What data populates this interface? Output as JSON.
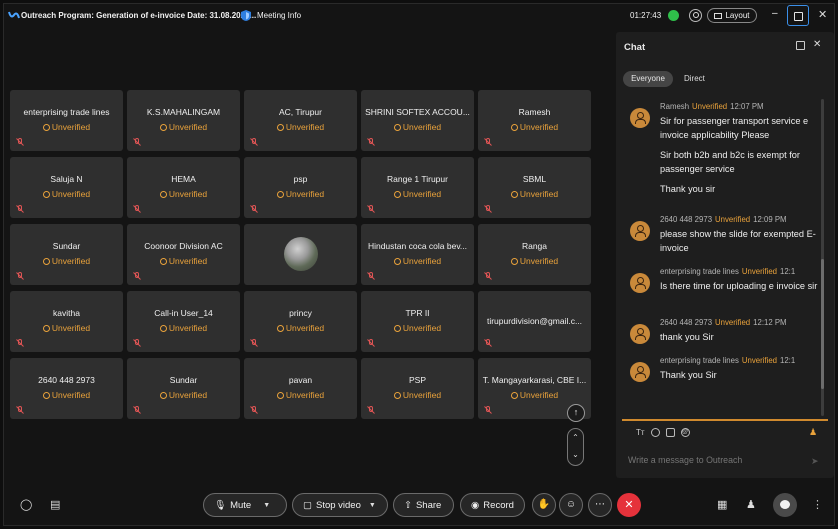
{
  "titlebar": {
    "meeting_title": "Outreach Program: Generation of e-invoice Date: 31.08.2023...",
    "meeting_info": "Meeting Info",
    "timer": "01:27:43",
    "layout_label": "Layout"
  },
  "colors": {
    "unverified": "#e9a23b",
    "end_call": "#e5323b",
    "accent_border": "#3b8fe8",
    "green_status": "#2fbf4a"
  },
  "participants": [
    [
      {
        "name": "enterprising trade lines",
        "status": "Unverified"
      },
      {
        "name": "K.S.MAHALINGAM",
        "status": "Unverified"
      },
      {
        "name": "AC, Tirupur",
        "status": "Unverified"
      },
      {
        "name": "SHRINI SOFTEX ACCOU...",
        "status": "Unverified"
      },
      {
        "name": "Ramesh",
        "status": "Unverified"
      }
    ],
    [
      {
        "name": "Saluja N",
        "status": "Unverified"
      },
      {
        "name": "HEMA",
        "status": "Unverified"
      },
      {
        "name": "psp",
        "status": "Unverified"
      },
      {
        "name": "Range 1 Tirupur",
        "status": "Unverified"
      },
      {
        "name": "SBML",
        "status": "Unverified"
      }
    ],
    [
      {
        "name": "Sundar",
        "status": "Unverified"
      },
      {
        "name": "Coonoor Division AC",
        "status": "Unverified"
      },
      {
        "name": "",
        "status": ""
      },
      {
        "name": "Hindustan coca cola bev...",
        "status": "Unverified"
      },
      {
        "name": "Ranga",
        "status": "Unverified"
      }
    ],
    [
      {
        "name": "kavitha",
        "status": "Unverified"
      },
      {
        "name": "Call-in User_14",
        "status": "Unverified"
      },
      {
        "name": "princy",
        "status": "Unverified"
      },
      {
        "name": "TPR II",
        "status": "Unverified"
      },
      {
        "name": "tirupurdivision@gmail.c...",
        "status": ""
      }
    ],
    [
      {
        "name": "2640 448 2973",
        "status": "Unverified"
      },
      {
        "name": "Sundar",
        "status": "Unverified"
      },
      {
        "name": "pavan",
        "status": "Unverified"
      },
      {
        "name": "PSP",
        "status": "Unverified"
      },
      {
        "name": "T. Mangayarkarasi, CBE I...",
        "status": "Unverified"
      }
    ]
  ],
  "chat": {
    "title": "Chat",
    "tabs": {
      "everyone": "Everyone",
      "direct": "Direct"
    },
    "messages": [
      {
        "sender": "Ramesh",
        "badge": "Unverified",
        "time": "12:07 PM",
        "lines": [
          "Sir for passenger transport service e invoice applicability Please",
          "Sir both b2b and b2c is exempt for passenger service",
          "Thank you sir"
        ]
      },
      {
        "sender": "2640 448 2973",
        "badge": "Unverified",
        "time": "12:09 PM",
        "lines": [
          "please show the slide for exempted E-invoice"
        ]
      },
      {
        "sender": "enterprising trade lines",
        "badge": "Unverified",
        "time": "12:1",
        "lines": [
          "Is there time for uploading e invoice sir"
        ]
      },
      {
        "sender": "2640 448 2973",
        "badge": "Unverified",
        "time": "12:12 PM",
        "lines": [
          "thank you Sir"
        ]
      },
      {
        "sender": "enterprising trade lines",
        "badge": "Unverified",
        "time": "12:1",
        "lines": [
          "Thank you Sir"
        ]
      }
    ],
    "composer": {
      "format_label": "Tт",
      "placeholder": "Write a message to Outreach"
    }
  },
  "controls": {
    "mute": "Mute",
    "stop_video": "Stop video",
    "share": "Share",
    "record": "Record"
  }
}
